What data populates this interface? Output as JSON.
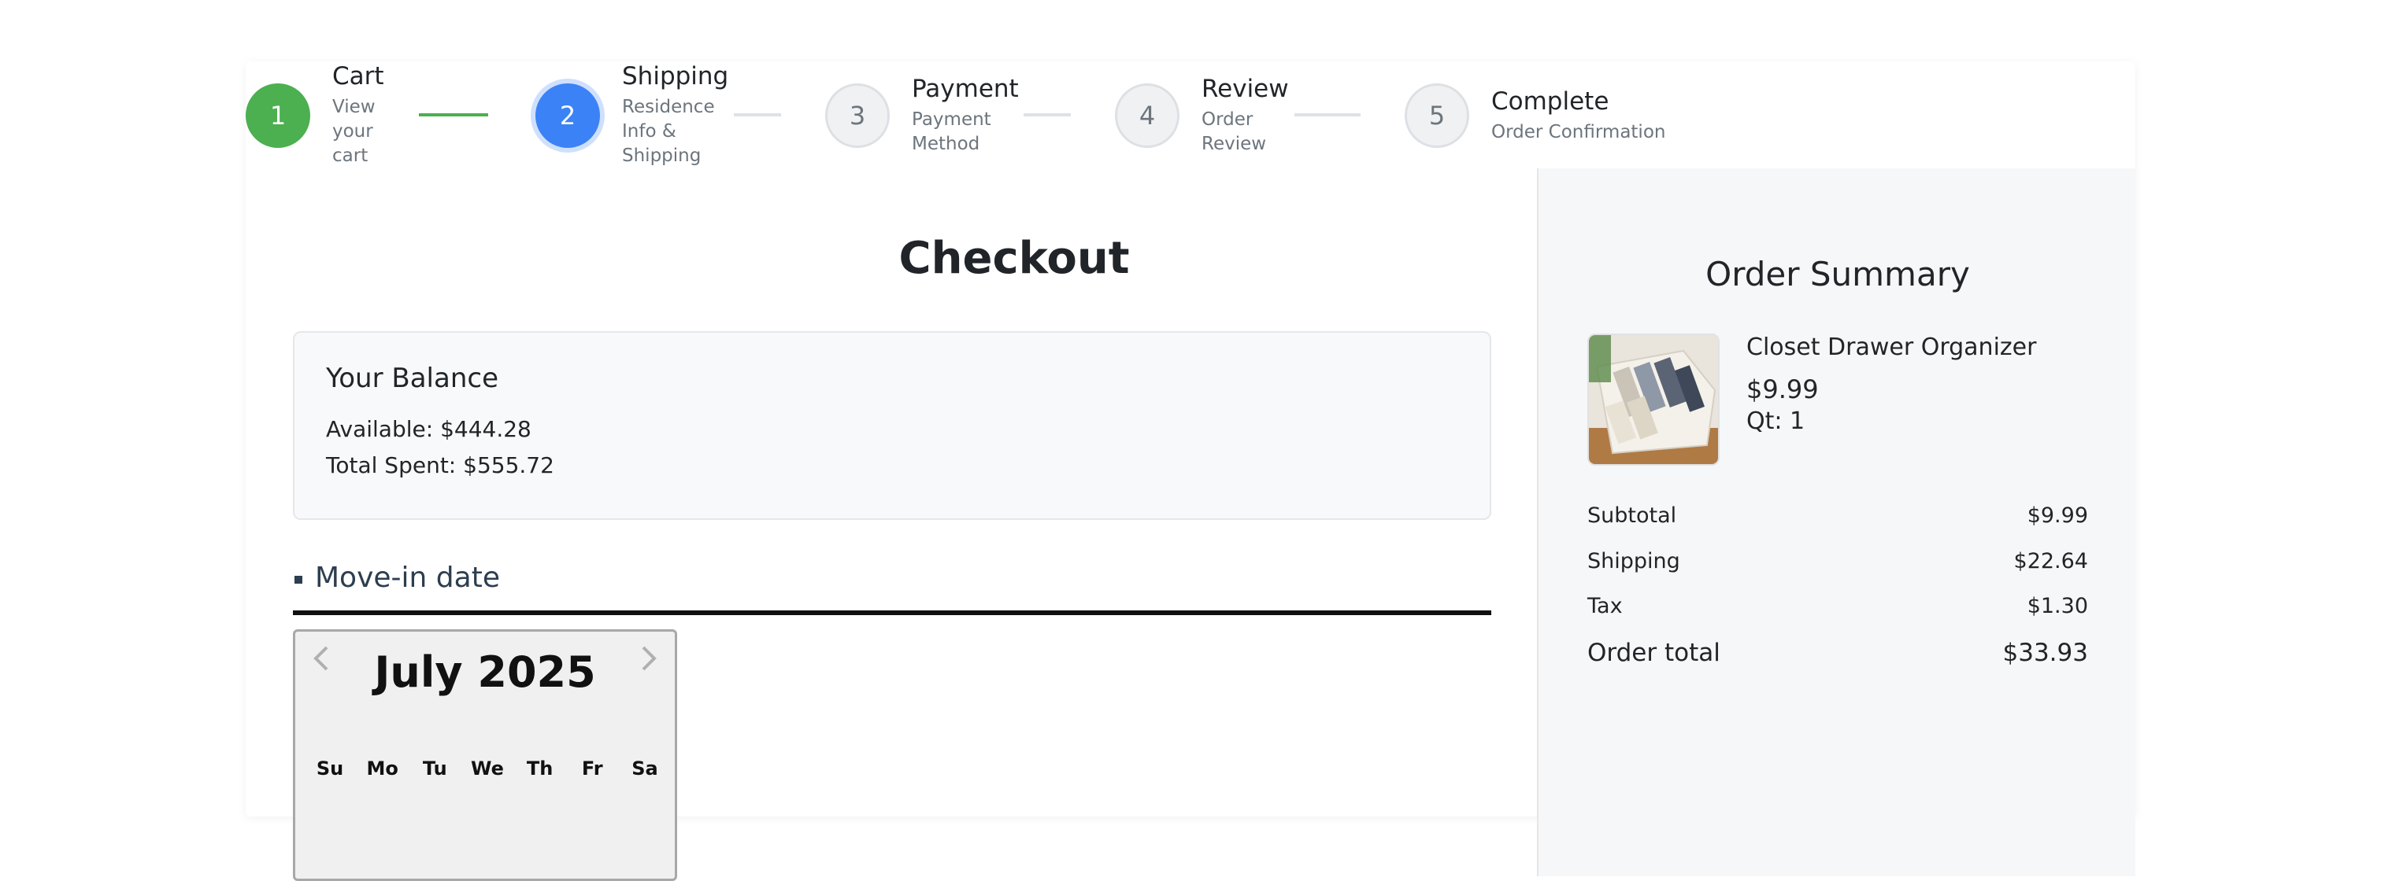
{
  "stepper": {
    "steps": [
      {
        "number": "1",
        "title": "Cart",
        "sub_lines": [
          "View",
          "your",
          "cart"
        ],
        "state": "done"
      },
      {
        "number": "2",
        "title": "Shipping",
        "sub_lines": [
          "Residence",
          "Info &",
          "Shipping"
        ],
        "state": "active"
      },
      {
        "number": "3",
        "title": "Payment",
        "sub_lines": [
          "Payment",
          "Method"
        ],
        "state": "pending"
      },
      {
        "number": "4",
        "title": "Review",
        "sub_lines": [
          "Order",
          "Review"
        ],
        "state": "pending"
      },
      {
        "number": "5",
        "title": "Complete",
        "sub_lines": [
          "Order Confirmation"
        ],
        "state": "pending"
      }
    ],
    "colors": {
      "done": "#4caf50",
      "active": "#3b82f6",
      "pending": "#f0f1f3"
    }
  },
  "main": {
    "title": "Checkout",
    "balance": {
      "heading": "Your Balance",
      "available": "Available: $444.28",
      "total_spent": "Total Spent: $555.72"
    },
    "move_in": {
      "label": "Move-in date"
    },
    "calendar": {
      "month_year": "July 2025",
      "prev_icon": "chevron-left-icon",
      "next_icon": "chevron-right-icon",
      "weekdays": [
        "Su",
        "Mo",
        "Tu",
        "We",
        "Th",
        "Fr",
        "Sa"
      ]
    }
  },
  "order_summary": {
    "title": "Order Summary",
    "item": {
      "name": "Closet Drawer Organizer",
      "price": "$9.99",
      "quantity": "Qt: 1"
    },
    "rows": {
      "subtotal": {
        "label": "Subtotal",
        "value": "$9.99"
      },
      "shipping": {
        "label": "Shipping",
        "value": "$22.64"
      },
      "tax": {
        "label": "Tax",
        "value": "$1.30"
      },
      "total": {
        "label": "Order total",
        "value": "$33.93"
      }
    }
  }
}
